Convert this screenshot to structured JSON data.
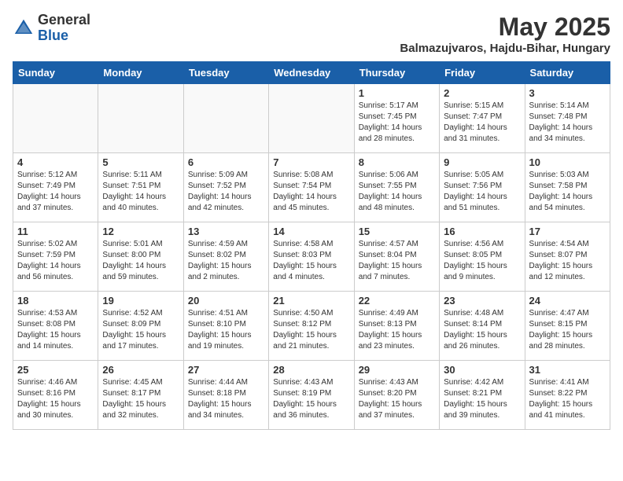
{
  "header": {
    "logo_general": "General",
    "logo_blue": "Blue",
    "month_year": "May 2025",
    "location": "Balmazujvaros, Hajdu-Bihar, Hungary"
  },
  "days_of_week": [
    "Sunday",
    "Monday",
    "Tuesday",
    "Wednesday",
    "Thursday",
    "Friday",
    "Saturday"
  ],
  "weeks": [
    [
      {
        "day": "",
        "info": ""
      },
      {
        "day": "",
        "info": ""
      },
      {
        "day": "",
        "info": ""
      },
      {
        "day": "",
        "info": ""
      },
      {
        "day": "1",
        "info": "Sunrise: 5:17 AM\nSunset: 7:45 PM\nDaylight: 14 hours and 28 minutes."
      },
      {
        "day": "2",
        "info": "Sunrise: 5:15 AM\nSunset: 7:47 PM\nDaylight: 14 hours and 31 minutes."
      },
      {
        "day": "3",
        "info": "Sunrise: 5:14 AM\nSunset: 7:48 PM\nDaylight: 14 hours and 34 minutes."
      }
    ],
    [
      {
        "day": "4",
        "info": "Sunrise: 5:12 AM\nSunset: 7:49 PM\nDaylight: 14 hours and 37 minutes."
      },
      {
        "day": "5",
        "info": "Sunrise: 5:11 AM\nSunset: 7:51 PM\nDaylight: 14 hours and 40 minutes."
      },
      {
        "day": "6",
        "info": "Sunrise: 5:09 AM\nSunset: 7:52 PM\nDaylight: 14 hours and 42 minutes."
      },
      {
        "day": "7",
        "info": "Sunrise: 5:08 AM\nSunset: 7:54 PM\nDaylight: 14 hours and 45 minutes."
      },
      {
        "day": "8",
        "info": "Sunrise: 5:06 AM\nSunset: 7:55 PM\nDaylight: 14 hours and 48 minutes."
      },
      {
        "day": "9",
        "info": "Sunrise: 5:05 AM\nSunset: 7:56 PM\nDaylight: 14 hours and 51 minutes."
      },
      {
        "day": "10",
        "info": "Sunrise: 5:03 AM\nSunset: 7:58 PM\nDaylight: 14 hours and 54 minutes."
      }
    ],
    [
      {
        "day": "11",
        "info": "Sunrise: 5:02 AM\nSunset: 7:59 PM\nDaylight: 14 hours and 56 minutes."
      },
      {
        "day": "12",
        "info": "Sunrise: 5:01 AM\nSunset: 8:00 PM\nDaylight: 14 hours and 59 minutes."
      },
      {
        "day": "13",
        "info": "Sunrise: 4:59 AM\nSunset: 8:02 PM\nDaylight: 15 hours and 2 minutes."
      },
      {
        "day": "14",
        "info": "Sunrise: 4:58 AM\nSunset: 8:03 PM\nDaylight: 15 hours and 4 minutes."
      },
      {
        "day": "15",
        "info": "Sunrise: 4:57 AM\nSunset: 8:04 PM\nDaylight: 15 hours and 7 minutes."
      },
      {
        "day": "16",
        "info": "Sunrise: 4:56 AM\nSunset: 8:05 PM\nDaylight: 15 hours and 9 minutes."
      },
      {
        "day": "17",
        "info": "Sunrise: 4:54 AM\nSunset: 8:07 PM\nDaylight: 15 hours and 12 minutes."
      }
    ],
    [
      {
        "day": "18",
        "info": "Sunrise: 4:53 AM\nSunset: 8:08 PM\nDaylight: 15 hours and 14 minutes."
      },
      {
        "day": "19",
        "info": "Sunrise: 4:52 AM\nSunset: 8:09 PM\nDaylight: 15 hours and 17 minutes."
      },
      {
        "day": "20",
        "info": "Sunrise: 4:51 AM\nSunset: 8:10 PM\nDaylight: 15 hours and 19 minutes."
      },
      {
        "day": "21",
        "info": "Sunrise: 4:50 AM\nSunset: 8:12 PM\nDaylight: 15 hours and 21 minutes."
      },
      {
        "day": "22",
        "info": "Sunrise: 4:49 AM\nSunset: 8:13 PM\nDaylight: 15 hours and 23 minutes."
      },
      {
        "day": "23",
        "info": "Sunrise: 4:48 AM\nSunset: 8:14 PM\nDaylight: 15 hours and 26 minutes."
      },
      {
        "day": "24",
        "info": "Sunrise: 4:47 AM\nSunset: 8:15 PM\nDaylight: 15 hours and 28 minutes."
      }
    ],
    [
      {
        "day": "25",
        "info": "Sunrise: 4:46 AM\nSunset: 8:16 PM\nDaylight: 15 hours and 30 minutes."
      },
      {
        "day": "26",
        "info": "Sunrise: 4:45 AM\nSunset: 8:17 PM\nDaylight: 15 hours and 32 minutes."
      },
      {
        "day": "27",
        "info": "Sunrise: 4:44 AM\nSunset: 8:18 PM\nDaylight: 15 hours and 34 minutes."
      },
      {
        "day": "28",
        "info": "Sunrise: 4:43 AM\nSunset: 8:19 PM\nDaylight: 15 hours and 36 minutes."
      },
      {
        "day": "29",
        "info": "Sunrise: 4:43 AM\nSunset: 8:20 PM\nDaylight: 15 hours and 37 minutes."
      },
      {
        "day": "30",
        "info": "Sunrise: 4:42 AM\nSunset: 8:21 PM\nDaylight: 15 hours and 39 minutes."
      },
      {
        "day": "31",
        "info": "Sunrise: 4:41 AM\nSunset: 8:22 PM\nDaylight: 15 hours and 41 minutes."
      }
    ]
  ]
}
